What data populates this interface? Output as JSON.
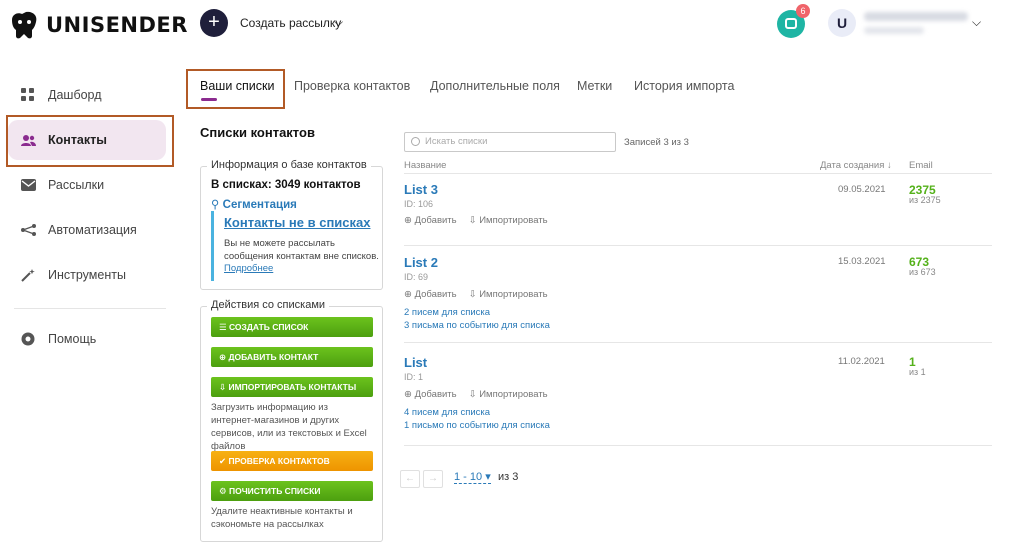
{
  "brand": {
    "name": "UNISENDER"
  },
  "header": {
    "create_label": "Создать рассылку",
    "notifications_count": "6",
    "user_initial": "U"
  },
  "sidebar": {
    "items": [
      {
        "label": "Дашборд",
        "icon": "dashboard-grid-icon"
      },
      {
        "label": "Контакты",
        "icon": "contacts-people-icon",
        "active": true
      },
      {
        "label": "Рассылки",
        "icon": "mail-envelope-icon"
      },
      {
        "label": "Автоматизация",
        "icon": "automation-flow-icon"
      },
      {
        "label": "Инструменты",
        "icon": "magic-wand-icon"
      },
      {
        "label": "Помощь",
        "icon": "help-globe-icon"
      }
    ]
  },
  "tabs": [
    {
      "label": "Ваши списки",
      "active": true
    },
    {
      "label": "Проверка контактов"
    },
    {
      "label": "Дополнительные поля"
    },
    {
      "label": "Метки"
    },
    {
      "label": "История импорта"
    }
  ],
  "main": {
    "title": "Списки контактов",
    "info": {
      "legend": "Информация о базе контактов",
      "count_text": "В списках: 3049 контактов",
      "segmentation_link": "Сегментация",
      "not_in_lists_title": "Контакты не в списках",
      "not_in_lists_text": "Вы не можете рассылать сообщения контактам вне списков.",
      "more_link": "Подробнее"
    },
    "actions": {
      "legend": "Действия со списками",
      "create_list": "создать список",
      "add_contact": "добавить контакт",
      "import_contacts": "импортировать контакты",
      "import_note": "Загрузить информацию из интернет-магазинов и других сервисов, или из текстовых и Excel файлов",
      "check_contacts": "проверка контактов",
      "clean_lists": "почистить списки",
      "clean_note": "Удалите неактивные контакты и сэкономьте на рассылках"
    },
    "search": {
      "placeholder": "Искать списки"
    },
    "records_text": "Записей 3 из 3",
    "columns": {
      "name": "Название",
      "date": "Дата создания ↓",
      "email": "Email"
    },
    "action_add": "Добавить",
    "action_import": "Импортировать",
    "lists": [
      {
        "name": "List 3",
        "id": "ID: 106",
        "date": "09.05.2021",
        "email": "2375",
        "email_of": "из 2375",
        "links": []
      },
      {
        "name": "List 2",
        "id": "ID: 69",
        "date": "15.03.2021",
        "email": "673",
        "email_of": "из 673",
        "links": [
          "2 писем для списка",
          "3 письма по событию для списка"
        ]
      },
      {
        "name": "List",
        "id": "ID: 1",
        "date": "11.02.2021",
        "email": "1",
        "email_of": "из 1",
        "links": [
          "4 писем для списка",
          "1 письмо по событию для списка"
        ]
      }
    ],
    "pager": {
      "range": "1 - 10",
      "of": "из 3"
    }
  },
  "colors": {
    "accent": "#8b2b8f",
    "link": "#2a7ab8",
    "green": "#54b11a",
    "highlight": "#b25a26"
  }
}
